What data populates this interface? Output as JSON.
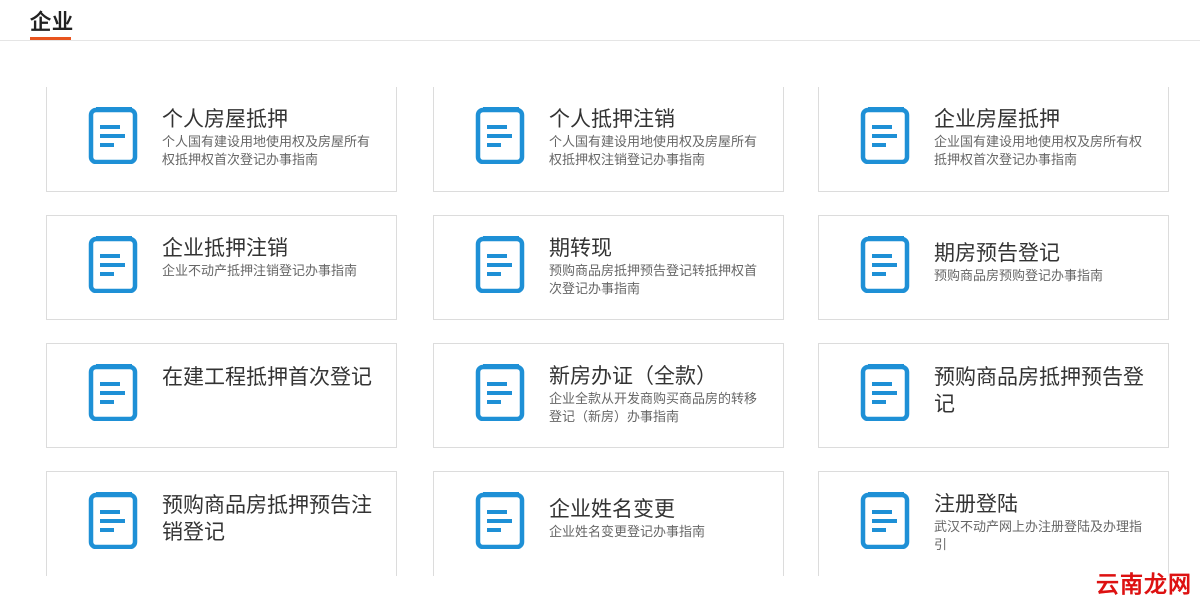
{
  "page_title": "企业",
  "watermark": "云南龙网",
  "colors": {
    "accent": "#e8541e",
    "icon": "#1e90d6"
  },
  "cards": [
    {
      "title": "个人房屋抵押",
      "desc": "个人国有建设用地使用权及房屋所有权抵押权首次登记办事指南",
      "icon": "document-icon"
    },
    {
      "title": "个人抵押注销",
      "desc": "个人国有建设用地使用权及房屋所有权抵押权注销登记办事指南",
      "icon": "document-icon"
    },
    {
      "title": "企业房屋抵押",
      "desc": "企业国有建设用地使用权及房所有权抵押权首次登记办事指南",
      "icon": "document-icon"
    },
    {
      "title": "企业抵押注销",
      "desc": "企业不动产抵押注销登记办事指南",
      "icon": "document-icon"
    },
    {
      "title": "期转现",
      "desc": "预购商品房抵押预告登记转抵押权首次登记办事指南",
      "icon": "document-icon"
    },
    {
      "title": "期房预告登记",
      "desc": "预购商品房预购登记办事指南",
      "icon": "document-icon"
    },
    {
      "title": "在建工程抵押首次登记",
      "desc": "",
      "icon": "document-icon"
    },
    {
      "title": "新房办证（全款）",
      "desc": "企业全款从开发商购买商品房的转移登记（新房）办事指南",
      "icon": "document-icon"
    },
    {
      "title": "预购商品房抵押预告登记",
      "desc": "",
      "icon": "document-icon"
    },
    {
      "title": "预购商品房抵押预告注销登记",
      "desc": "",
      "icon": "document-icon"
    },
    {
      "title": "企业姓名变更",
      "desc": "企业姓名变更登记办事指南",
      "icon": "document-icon"
    },
    {
      "title": "注册登陆",
      "desc": "武汉不动产网上办注册登陆及办理指引",
      "icon": "document-icon"
    }
  ]
}
